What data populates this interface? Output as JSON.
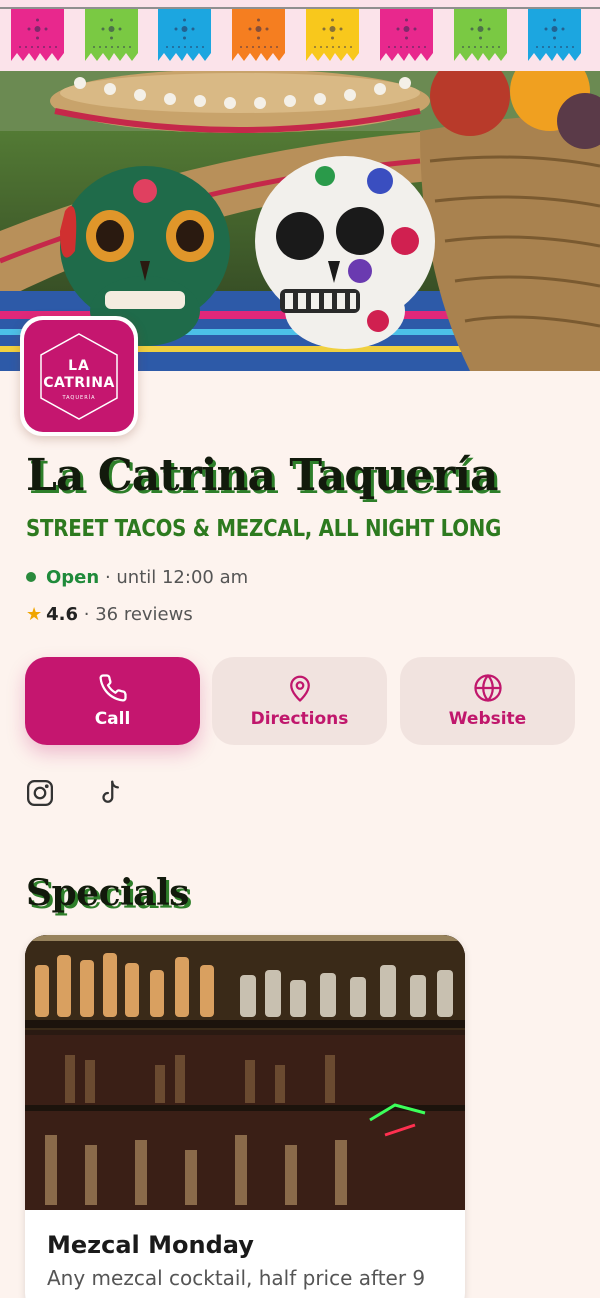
{
  "banner": {
    "flag_colors": [
      "#e8288d",
      "#7ac943",
      "#1ca6e0",
      "#f57e20",
      "#f8c81c",
      "#e8288d",
      "#7ac943",
      "#1ca6e0"
    ]
  },
  "hero": {
    "image_icon": "sugar-skulls-photo"
  },
  "logo": {
    "line1": "LA",
    "line2": "CATRINA",
    "line3": "TAQUERÍA"
  },
  "restaurant": {
    "name": "La Catrina Taquería",
    "tagline": "STREET TACOS & MEZCAL, ALL NIGHT LONG",
    "status": "Open",
    "hours": " · until 12:00 am",
    "rating": "4.6",
    "reviews": " · 36 reviews"
  },
  "actions": {
    "call": "Call",
    "directions": "Directions",
    "website": "Website"
  },
  "social": {
    "instagram_icon": "instagram-icon",
    "tiktok_icon": "tiktok-icon"
  },
  "specials": {
    "heading": "Specials",
    "items": [
      {
        "title": "Mezcal Monday",
        "description": "Any mezcal cocktail, half price after 9"
      }
    ]
  },
  "colors": {
    "brand": "#c5166f",
    "accent_green": "#2d7a1f",
    "background": "#fdf3ee"
  }
}
